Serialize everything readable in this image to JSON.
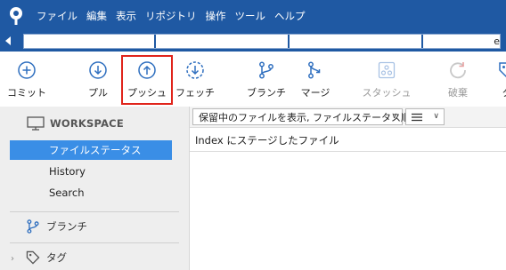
{
  "menu": {
    "items": [
      "ファイル",
      "編集",
      "表示",
      "リポジトリ",
      "操作",
      "ツール",
      "ヘルプ"
    ]
  },
  "tabstrip": {
    "trailing_text": "e"
  },
  "toolbar": {
    "buttons": [
      {
        "label": "コミット",
        "icon": "plus-circle-icon",
        "state": "enabled"
      },
      {
        "label": "プル",
        "icon": "arrow-down-circle-icon",
        "state": "enabled"
      },
      {
        "label": "プッシュ",
        "icon": "arrow-up-circle-icon",
        "state": "enabled",
        "highlighted": true
      },
      {
        "label": "フェッチ",
        "icon": "dashed-arrow-down-circle-icon",
        "state": "enabled"
      },
      {
        "label": "ブランチ",
        "icon": "branch-icon",
        "state": "enabled"
      },
      {
        "label": "マージ",
        "icon": "merge-icon",
        "state": "enabled"
      },
      {
        "label": "スタッシュ",
        "icon": "stash-icon",
        "state": "disabled"
      },
      {
        "label": "破棄",
        "icon": "discard-icon",
        "state": "disabled"
      },
      {
        "label": "タ",
        "icon": "tag-icon",
        "state": "enabled"
      }
    ],
    "highlight_color": "#e0241b"
  },
  "sidebar": {
    "workspace_label": "WORKSPACE",
    "items": [
      "ファイルステータス",
      "History",
      "Search"
    ],
    "active_item": "ファイルステータス",
    "groups": [
      "ブランチ",
      "タグ"
    ]
  },
  "main": {
    "filter_dropdown": "保留中のファイルを表示, ファイルステータス順",
    "view_dropdown_icon": "list-icon",
    "section_title": "Index にステージしたファイル"
  },
  "colors": {
    "menubar": "#1f59a3",
    "accent_selection": "#3a8ee6",
    "icon_blue": "#2f6fbf"
  }
}
